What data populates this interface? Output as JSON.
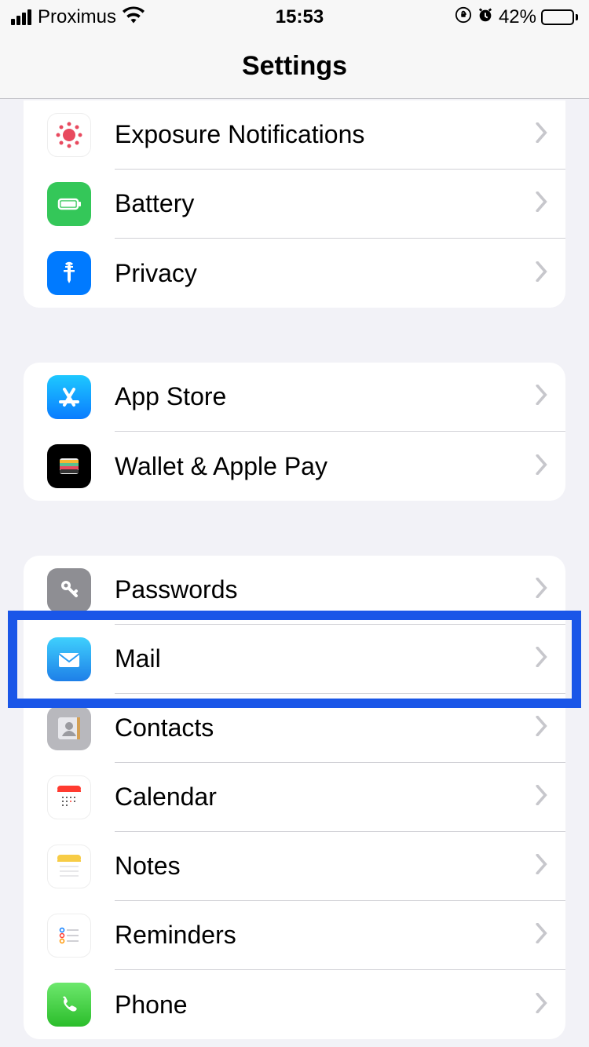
{
  "status": {
    "carrier": "Proximus",
    "time": "15:53",
    "battery_pct": "42%",
    "battery_fill": 42
  },
  "nav": {
    "title": "Settings"
  },
  "groups": [
    {
      "items": [
        {
          "id": "exposure",
          "label": "Exposure Notifications",
          "icon": "exposure-icon"
        },
        {
          "id": "battery",
          "label": "Battery",
          "icon": "battery-icon"
        },
        {
          "id": "privacy",
          "label": "Privacy",
          "icon": "privacy-icon"
        }
      ]
    },
    {
      "items": [
        {
          "id": "appstore",
          "label": "App Store",
          "icon": "appstore-icon"
        },
        {
          "id": "wallet",
          "label": "Wallet & Apple Pay",
          "icon": "wallet-icon"
        }
      ]
    },
    {
      "items": [
        {
          "id": "passwords",
          "label": "Passwords",
          "icon": "passwords-icon"
        },
        {
          "id": "mail",
          "label": "Mail",
          "icon": "mail-icon",
          "highlighted": true
        },
        {
          "id": "contacts",
          "label": "Contacts",
          "icon": "contacts-icon"
        },
        {
          "id": "calendar",
          "label": "Calendar",
          "icon": "calendar-icon"
        },
        {
          "id": "notes",
          "label": "Notes",
          "icon": "notes-icon"
        },
        {
          "id": "reminders",
          "label": "Reminders",
          "icon": "reminders-icon"
        },
        {
          "id": "phone",
          "label": "Phone",
          "icon": "phone-icon"
        }
      ]
    }
  ]
}
